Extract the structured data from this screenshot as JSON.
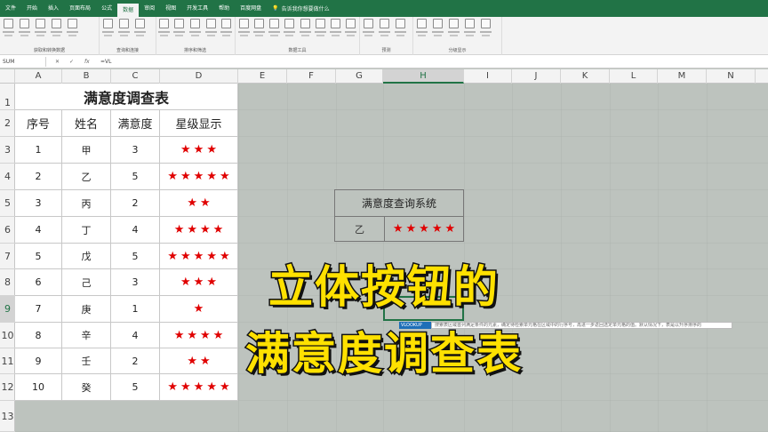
{
  "ribbon": {
    "tabs": [
      "文件",
      "开始",
      "插入",
      "页面布局",
      "公式",
      "数据",
      "审阅",
      "视图",
      "开发工具",
      "帮助",
      "百度网盘"
    ],
    "active_tab": "数据",
    "tell_me": "告诉我你想要做什么",
    "groups": [
      "获取和转换数据",
      "查询和连接",
      "排序和筛选",
      "数据工具",
      "预测",
      "分级显示"
    ]
  },
  "formula_bar": {
    "name_box": "SUM",
    "cancel": "✕",
    "enter": "✓",
    "fx": "fx",
    "formula": "=VL"
  },
  "grid": {
    "columns": [
      "A",
      "B",
      "C",
      "D",
      "E",
      "F",
      "G",
      "H",
      "I",
      "J",
      "K",
      "L",
      "M",
      "N"
    ],
    "rows": [
      "1",
      "2",
      "3",
      "4",
      "5",
      "6",
      "7",
      "8",
      "9",
      "10",
      "11",
      "12",
      "13"
    ],
    "selected_column": "H",
    "selected_row": "9"
  },
  "survey": {
    "title": "满意度调查表",
    "headers": [
      "序号",
      "姓名",
      "满意度",
      "星级显示"
    ],
    "rows": [
      {
        "no": "1",
        "name": "甲",
        "score": "3",
        "stars": "★★★"
      },
      {
        "no": "2",
        "name": "乙",
        "score": "5",
        "stars": "★★★★★"
      },
      {
        "no": "3",
        "name": "丙",
        "score": "2",
        "stars": "★★"
      },
      {
        "no": "4",
        "name": "丁",
        "score": "4",
        "stars": "★★★★"
      },
      {
        "no": "5",
        "name": "戊",
        "score": "5",
        "stars": "★★★★★"
      },
      {
        "no": "6",
        "name": "己",
        "score": "3",
        "stars": "★★★"
      },
      {
        "no": "7",
        "name": "庚",
        "score": "1",
        "stars": "★"
      },
      {
        "no": "8",
        "name": "辛",
        "score": "4",
        "stars": "★★★★"
      },
      {
        "no": "9",
        "name": "壬",
        "score": "2",
        "stars": "★★"
      },
      {
        "no": "10",
        "name": "癸",
        "score": "5",
        "stars": "★★★★★"
      }
    ]
  },
  "query": {
    "title": "满意度查询系统",
    "name": "乙",
    "stars": "★★★★★",
    "star_color": "#e00000"
  },
  "formula_input": {
    "partial": "=VL",
    "autocomplete": "VLOOKUP",
    "tooltip": "搜索表区域首列满足条件的元素，确定待检索单元格在区域中的行序号，再进一步返回选定单元格的值。默认情况下，表是以升序排序的"
  },
  "caption": {
    "line1": "立体按钮的",
    "line2": "满意度调查表"
  },
  "colors": {
    "excel_green": "#217346",
    "sheet_bg": "#bdc3be",
    "caption_yellow": "#ffe100"
  }
}
